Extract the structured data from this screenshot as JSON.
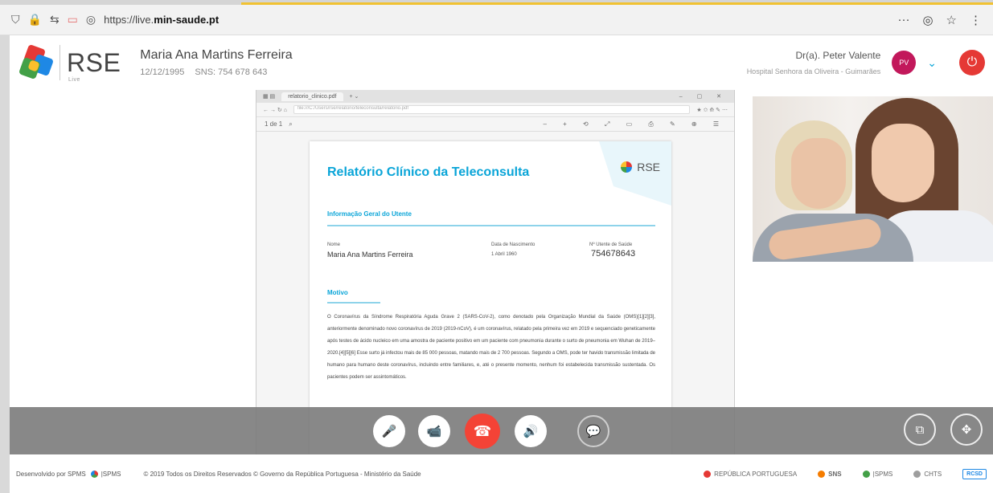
{
  "browser": {
    "url_prefix": "https://live.",
    "url_host": "min-saude.pt",
    "more": "···",
    "pocket": "◎",
    "star": "☆",
    "menu": "⋮"
  },
  "header": {
    "logo_text": "RSE",
    "logo_sub": "Live",
    "patient_name": "Maria Ana Martins Ferreira",
    "patient_dob": "12/12/1995",
    "patient_sns": "SNS: 754 678 643",
    "doctor_name": "Dr(a). Peter Valente",
    "doctor_hospital": "Hospital Senhora da Oliveira - Guimarães",
    "avatar_initials": "PV"
  },
  "document_viewer": {
    "tab_label": "relatorio_clinico.pdf",
    "address": "file:///C:/Users/rse/relatorio/teleconsulta/relatorio.pdf",
    "page_indicator": "1 de 1",
    "doc_title": "Relatório Clínico da Teleconsulta",
    "doc_logo": "RSE",
    "section1": "Informação Geral do Utente",
    "name_label": "Nome",
    "name_value": "Maria Ana Martins Ferreira",
    "dob_label": "Data de Nascimento",
    "dob_value": "1 Abril 1960",
    "user_no_label": "Nº Utente de Saúde",
    "user_no_value": "754678643",
    "section2": "Motivo",
    "body": "O Coronavírus da Síndrome Respiratória Aguda Grave 2 (SARS-CoV-2), como denotado pela Organização Mundial da Saúde (OMS)[1][2][3], anteriormente denominado novo coronavírus de 2019 (2019-nCoV), é um coronavírus, relatado pela primeira vez em 2019 e sequenciado geneticamente após testes de ácido nucleico em uma amostra de paciente positivo em um paciente com pneumonia durante o surto de pneumonia em Wuhan de 2019–2020.[4][5][6] Esse surto já infectou mais de 85 000 pessoas, matando mais de 2 700 pessoas. Segundo a OMS, pode ter havido transmissão limitada de humano para humano deste coronavírus, incluindo entre familiares, e, até o presente momento, nenhum foi estabelecida transmissão sustentada. Os pacientes podem ser assintomáticos."
  },
  "call_controls": {
    "mic": "🎤",
    "camera": "📹",
    "hangup": "☎",
    "volume": "🔊",
    "chat": "💬",
    "share": "⧉",
    "move": "✥"
  },
  "footer": {
    "developed_by": "Desenvolvido por SPMS",
    "spms_logo": "|SPMS",
    "copyright": "© 2019 Todos os Direitos Reservados © Governo da República Portuguesa - Ministério da Saúde",
    "brand1": "REPÚBLICA PORTUGUESA",
    "brand2": "SNS",
    "brand3": "|SPMS",
    "brand4": "CHTS",
    "brand5": "RCSD"
  },
  "colors": {
    "accent": "#0aa5d8",
    "hangup": "#f44336",
    "power": "#e53935",
    "avatar": "#c2185b"
  }
}
